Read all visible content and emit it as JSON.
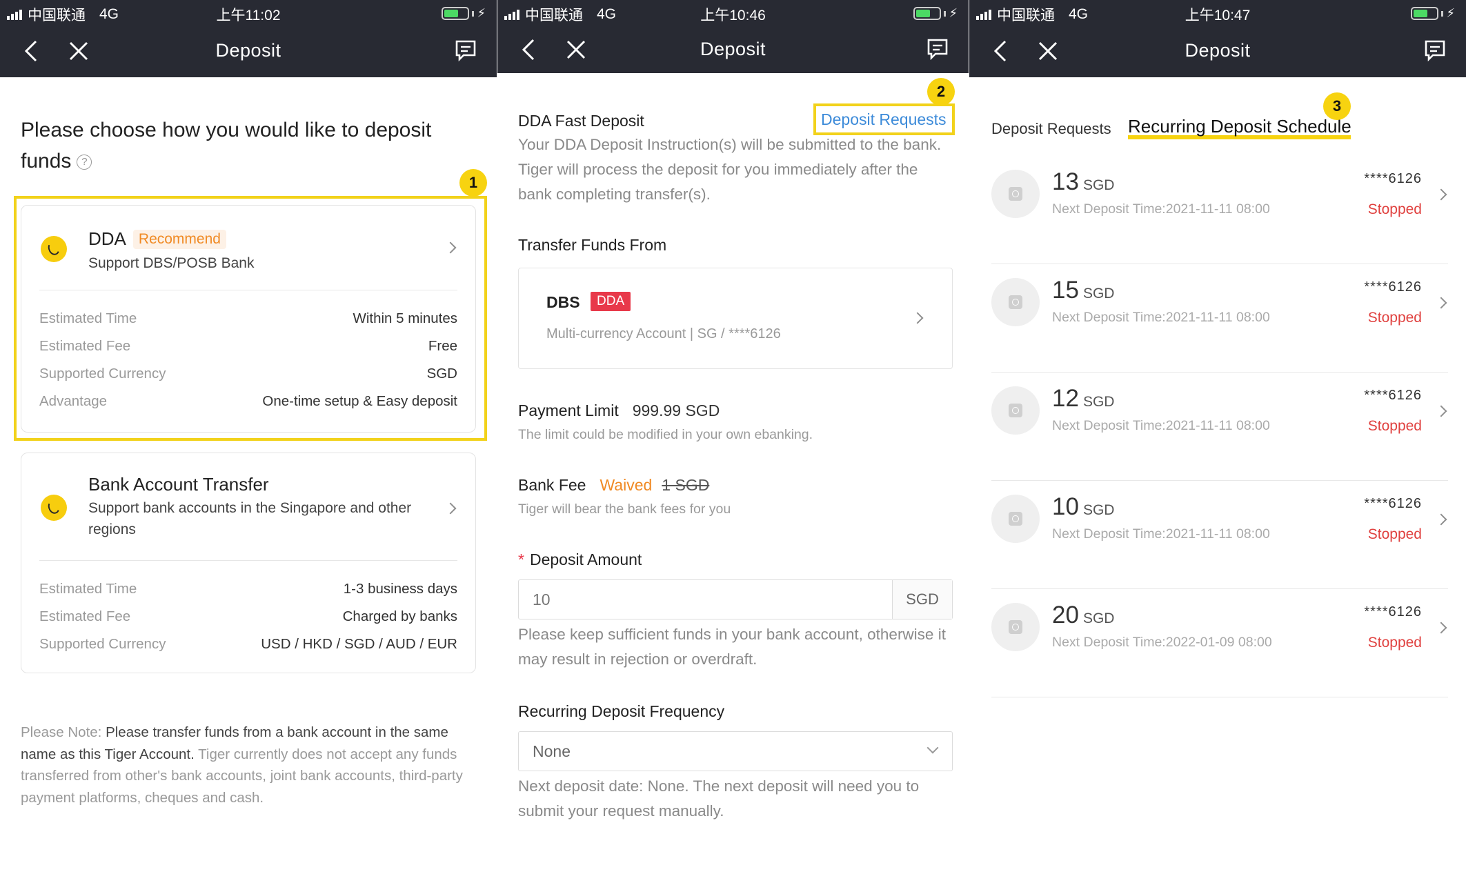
{
  "status_bars": [
    {
      "carrier": "中国联通",
      "network": "4G",
      "time": "上午11:02"
    },
    {
      "carrier": "中国联通",
      "network": "4G",
      "time": "上午10:46"
    },
    {
      "carrier": "中国联通",
      "network": "4G",
      "time": "上午10:47"
    }
  ],
  "nav": {
    "title": "Deposit",
    "icons": [
      "back-icon",
      "close-icon",
      "message-icon"
    ]
  },
  "colors": {
    "topbar": "#282a33",
    "highlight": "#f2d21b",
    "callout": "#f7d310",
    "accent_orange": "#f08a24",
    "link_blue": "#3d8bd9",
    "status_red": "#e0413f",
    "tag_red": "#e8394a"
  },
  "callouts": [
    "1",
    "2",
    "3"
  ],
  "screen1": {
    "heading": "Please choose how you would like to deposit funds",
    "methods": [
      {
        "title": "DDA",
        "badge": "Recommend",
        "subtitle": "Support DBS/POSB Bank",
        "rows": [
          {
            "label": "Estimated Time",
            "value": "Within 5 minutes"
          },
          {
            "label": "Estimated Fee",
            "value": "Free"
          },
          {
            "label": "Supported Currency",
            "value": "SGD"
          },
          {
            "label": "Advantage",
            "value": "One-time setup & Easy deposit"
          }
        ]
      },
      {
        "title": "Bank Account Transfer",
        "subtitle": "Support bank accounts in the Singapore and other regions",
        "rows": [
          {
            "label": "Estimated Time",
            "value": "1-3 business days"
          },
          {
            "label": "Estimated Fee",
            "value": "Charged by banks"
          },
          {
            "label": "Supported Currency",
            "value": "USD / HKD / SGD / AUD / EUR"
          }
        ]
      }
    ],
    "note": {
      "prefix": "Please Note: ",
      "bold": "Please transfer funds from a bank account in the same name as this Tiger Account.",
      "rest": " Tiger currently does not accept any funds transferred from other's bank accounts, joint bank accounts, third-party payment platforms, cheques and cash."
    }
  },
  "screen2": {
    "section_title": "DDA Fast Deposit",
    "requests_link": "Deposit Requests",
    "description": "Your DDA Deposit Instruction(s) will be submitted to the bank. Tiger will process the deposit for you immediately after the bank completing transfer(s).",
    "transfer_from_label": "Transfer Funds From",
    "bank": {
      "name": "DBS",
      "tag": "DDA",
      "account": "Multi-currency Account  |  SG / ****6126"
    },
    "payment_limit": {
      "label": "Payment Limit",
      "value": "999.99 SGD",
      "note": "The limit could be modified in your own ebanking."
    },
    "bank_fee": {
      "label": "Bank Fee",
      "waived": "Waived",
      "original": "1 SGD",
      "note": "Tiger will bear the bank fees for you"
    },
    "deposit_amount": {
      "required_mark": "*",
      "label": "Deposit Amount",
      "value": "10",
      "currency": "SGD",
      "note": "Please keep sufficient funds in your bank account, otherwise it may result in rejection or overdraft."
    },
    "frequency": {
      "label": "Recurring Deposit Frequency",
      "value": "None",
      "note": "Next deposit date: None. The next deposit will need you to submit your request manually."
    }
  },
  "screen3": {
    "tabs": [
      "Deposit Requests",
      "Recurring Deposit Schedule"
    ],
    "active_tab": 1,
    "records": [
      {
        "amount": "13",
        "currency": "SGD",
        "next": "Next Deposit Time:2021-11-11 08:00",
        "account": "****6126",
        "status": "Stopped"
      },
      {
        "amount": "15",
        "currency": "SGD",
        "next": "Next Deposit Time:2021-11-11 08:00",
        "account": "****6126",
        "status": "Stopped"
      },
      {
        "amount": "12",
        "currency": "SGD",
        "next": "Next Deposit Time:2021-11-11 08:00",
        "account": "****6126",
        "status": "Stopped"
      },
      {
        "amount": "10",
        "currency": "SGD",
        "next": "Next Deposit Time:2021-11-11 08:00",
        "account": "****6126",
        "status": "Stopped"
      },
      {
        "amount": "20",
        "currency": "SGD",
        "next": "Next Deposit Time:2022-01-09 08:00",
        "account": "****6126",
        "status": "Stopped"
      }
    ]
  }
}
